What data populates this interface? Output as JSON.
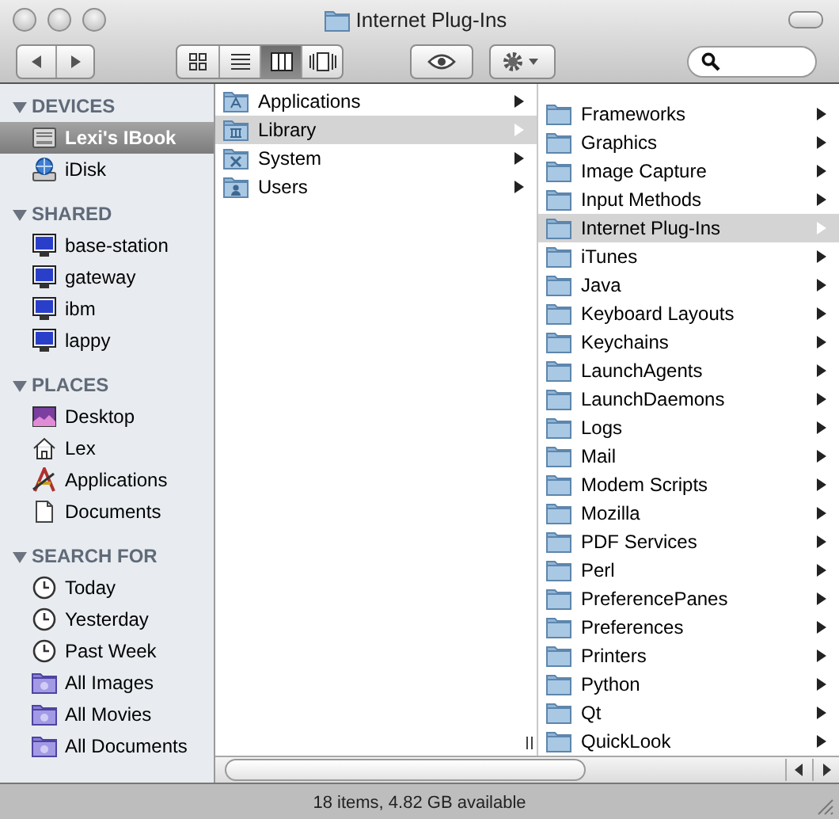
{
  "window": {
    "title": "Internet Plug-Ins"
  },
  "toolbar": {
    "view_buttons": [
      {
        "kind": "icons",
        "selected": false
      },
      {
        "kind": "list",
        "selected": false
      },
      {
        "kind": "columns",
        "selected": true
      },
      {
        "kind": "coverflow",
        "selected": false
      }
    ]
  },
  "sidebar": {
    "sections": [
      {
        "title": "DEVICES",
        "expanded": true,
        "items": [
          {
            "label": "Lexi's IBook",
            "kind": "disk",
            "selected": true
          },
          {
            "label": "iDisk",
            "kind": "idisk",
            "selected": false
          }
        ]
      },
      {
        "title": "SHARED",
        "expanded": true,
        "items": [
          {
            "label": "base-station",
            "kind": "monitor",
            "selected": false
          },
          {
            "label": "gateway",
            "kind": "monitor",
            "selected": false
          },
          {
            "label": "ibm",
            "kind": "monitor",
            "selected": false
          },
          {
            "label": "lappy",
            "kind": "monitor",
            "selected": false
          }
        ]
      },
      {
        "title": "PLACES",
        "expanded": true,
        "items": [
          {
            "label": "Desktop",
            "kind": "desktop",
            "selected": false
          },
          {
            "label": "Lex",
            "kind": "home",
            "selected": false
          },
          {
            "label": "Applications",
            "kind": "apps",
            "selected": false
          },
          {
            "label": "Documents",
            "kind": "document",
            "selected": false
          }
        ]
      },
      {
        "title": "SEARCH FOR",
        "expanded": true,
        "items": [
          {
            "label": "Today",
            "kind": "clock",
            "selected": false
          },
          {
            "label": "Yesterday",
            "kind": "clock",
            "selected": false
          },
          {
            "label": "Past Week",
            "kind": "clock",
            "selected": false
          },
          {
            "label": "All Images",
            "kind": "smart",
            "selected": false
          },
          {
            "label": "All Movies",
            "kind": "smart",
            "selected": false
          },
          {
            "label": "All Documents",
            "kind": "smart",
            "selected": false
          }
        ]
      }
    ]
  },
  "columns": [
    {
      "items": [
        {
          "label": "Applications",
          "kind": "apps-folder",
          "selected": false
        },
        {
          "label": "Library",
          "kind": "library-folder",
          "selected": true
        },
        {
          "label": "System",
          "kind": "system-folder",
          "selected": false
        },
        {
          "label": "Users",
          "kind": "users-folder",
          "selected": false
        }
      ]
    },
    {
      "items": [
        {
          "label": "Frameworks",
          "kind": "folder",
          "selected": false
        },
        {
          "label": "Graphics",
          "kind": "folder",
          "selected": false
        },
        {
          "label": "Image Capture",
          "kind": "folder",
          "selected": false
        },
        {
          "label": "Input Methods",
          "kind": "folder",
          "selected": false
        },
        {
          "label": "Internet Plug-Ins",
          "kind": "folder",
          "selected": true
        },
        {
          "label": "iTunes",
          "kind": "folder",
          "selected": false
        },
        {
          "label": "Java",
          "kind": "folder",
          "selected": false
        },
        {
          "label": "Keyboard Layouts",
          "kind": "folder",
          "selected": false
        },
        {
          "label": "Keychains",
          "kind": "folder",
          "selected": false
        },
        {
          "label": "LaunchAgents",
          "kind": "folder",
          "selected": false
        },
        {
          "label": "LaunchDaemons",
          "kind": "folder",
          "selected": false
        },
        {
          "label": "Logs",
          "kind": "folder",
          "selected": false
        },
        {
          "label": "Mail",
          "kind": "folder",
          "selected": false
        },
        {
          "label": "Modem Scripts",
          "kind": "folder",
          "selected": false
        },
        {
          "label": "Mozilla",
          "kind": "folder",
          "selected": false
        },
        {
          "label": "PDF Services",
          "kind": "folder",
          "selected": false
        },
        {
          "label": "Perl",
          "kind": "folder",
          "selected": false
        },
        {
          "label": "PreferencePanes",
          "kind": "folder",
          "selected": false
        },
        {
          "label": "Preferences",
          "kind": "folder",
          "selected": false
        },
        {
          "label": "Printers",
          "kind": "folder",
          "selected": false
        },
        {
          "label": "Python",
          "kind": "folder",
          "selected": false
        },
        {
          "label": "Qt",
          "kind": "folder",
          "selected": false
        },
        {
          "label": "QuickLook",
          "kind": "folder",
          "selected": false
        }
      ]
    }
  ],
  "status_bar": {
    "text": "18 items, 4.82 GB available"
  }
}
